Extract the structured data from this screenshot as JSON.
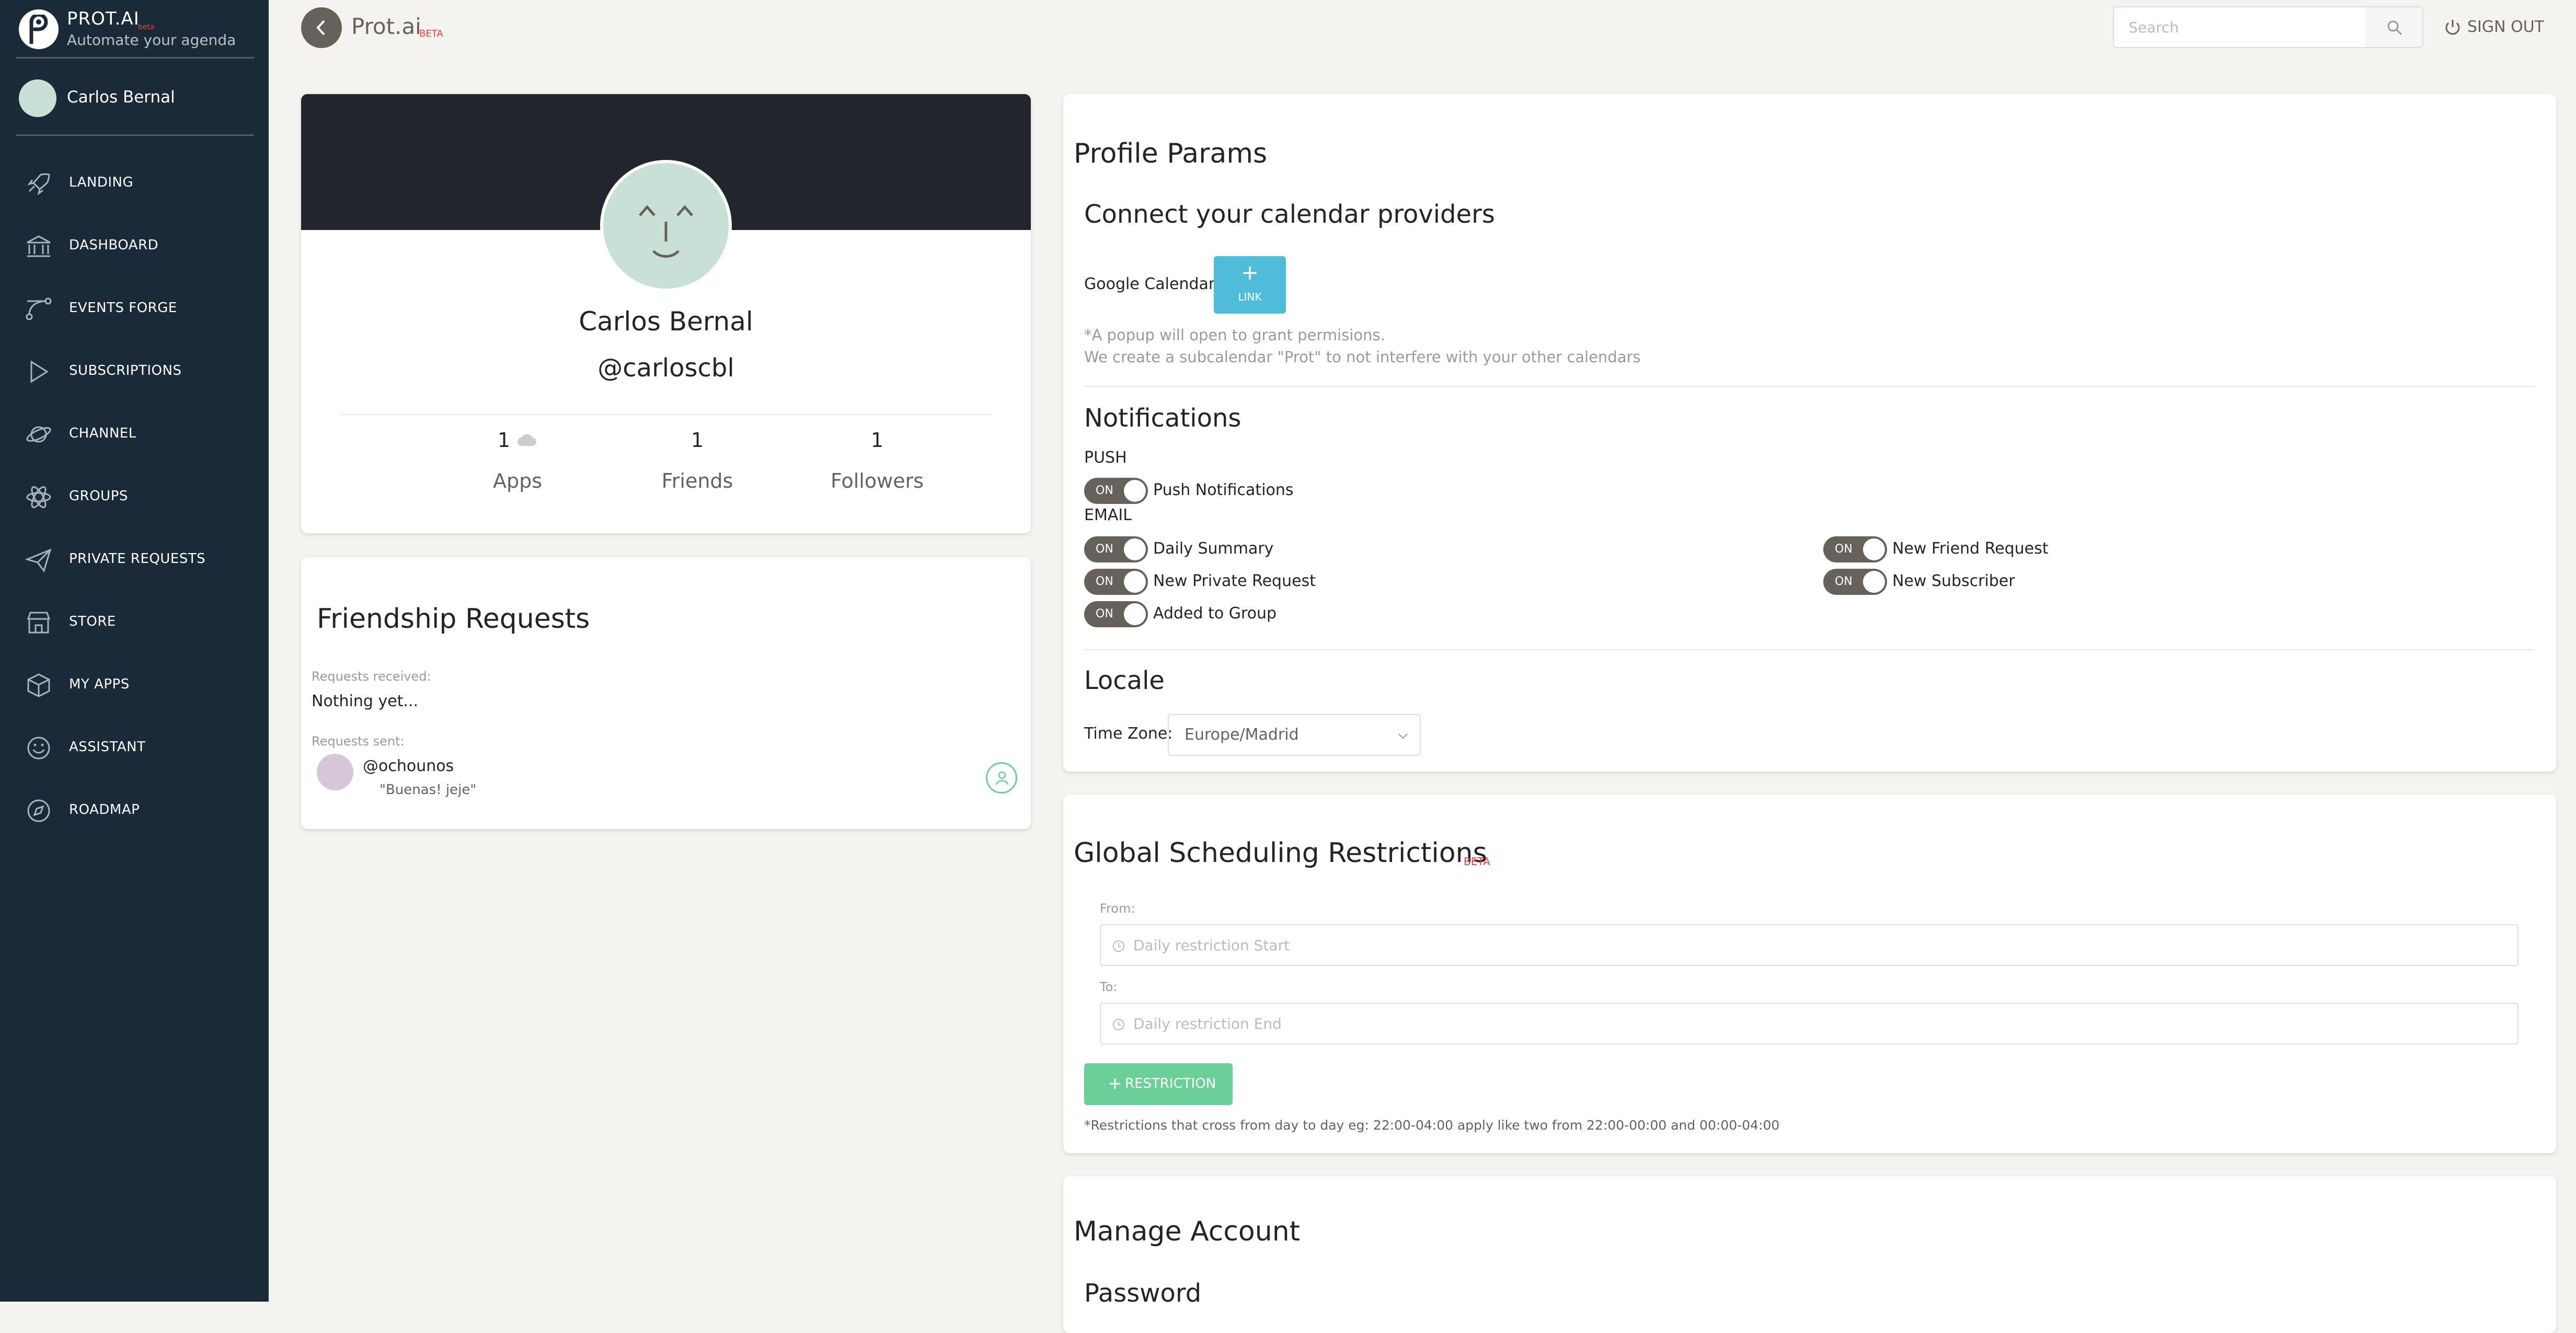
{
  "colors": {
    "sidebar_bg": "#1b2a38",
    "page_bg": "#f4f3ef",
    "accent_info": "#51bcda",
    "accent_success": "#6bd098",
    "beta_red": "#ef3b3b",
    "toggle_bg": "#66615b"
  },
  "sidebar": {
    "brand": {
      "name": "PROT.AI",
      "beta": "beta",
      "tagline": "Automate your agenda"
    },
    "user": {
      "name": "Carlos Bernal"
    },
    "items": [
      {
        "label": "LANDING",
        "icon": "rocket-icon"
      },
      {
        "label": "DASHBOARD",
        "icon": "bank-icon"
      },
      {
        "label": "EVENTS FORGE",
        "icon": "vector-nodes-icon"
      },
      {
        "label": "SUBSCRIPTIONS",
        "icon": "play-icon"
      },
      {
        "label": "CHANNEL",
        "icon": "planet-icon"
      },
      {
        "label": "GROUPS",
        "icon": "atom-icon"
      },
      {
        "label": "PRIVATE REQUESTS",
        "icon": "send-icon"
      },
      {
        "label": "STORE",
        "icon": "shop-icon"
      },
      {
        "label": "MY APPS",
        "icon": "box-icon"
      },
      {
        "label": "ASSISTANT",
        "icon": "smile-icon"
      },
      {
        "label": "ROADMAP",
        "icon": "compass-icon"
      }
    ]
  },
  "topbar": {
    "title": "Prot.ai",
    "beta": "BETA",
    "search_placeholder": "Search",
    "signout_label": "SIGN OUT"
  },
  "profile": {
    "name": "Carlos Bernal",
    "handle": "@carloscbl",
    "stats": [
      {
        "value": "1",
        "icon": "cloud-icon",
        "label": "Apps"
      },
      {
        "value": "1",
        "label": "Friends"
      },
      {
        "value": "1",
        "label": "Followers"
      }
    ]
  },
  "friendship": {
    "title": "Friendship Requests",
    "received_label": "Requests received:",
    "received_empty": "Nothing yet...",
    "sent_label": "Requests sent:",
    "sent": [
      {
        "handle": "@ochounos",
        "message": "\"Buenas! jeje\""
      }
    ]
  },
  "params": {
    "title": "Profile Params",
    "calendar": {
      "heading": "Connect your calendar providers",
      "google_label": "Google Calendar:",
      "link_plus": "+",
      "link_label": "LINK",
      "note1": "*A popup will open to grant permisions.",
      "note2": "We create a subcalendar \"Prot\" to not interfere with your other calendars"
    },
    "notifications": {
      "heading": "Notifications",
      "push_label": "PUSH",
      "email_label": "EMAIL",
      "on_text": "ON",
      "push": [
        {
          "label": "Push Notifications",
          "on": true
        }
      ],
      "email_left": [
        {
          "label": "Daily Summary",
          "on": true
        },
        {
          "label": "New Private Request",
          "on": true
        },
        {
          "label": "Added to Group",
          "on": true
        }
      ],
      "email_right": [
        {
          "label": "New Friend Request",
          "on": true
        },
        {
          "label": "New Subscriber",
          "on": true
        }
      ]
    },
    "locale": {
      "heading": "Locale",
      "timezone_label": "Time Zone:",
      "timezone_value": "Europe/Madrid"
    }
  },
  "scheduling": {
    "title": "Global Scheduling Restrictions",
    "beta": "BETA",
    "from_label": "From:",
    "from_placeholder": "Daily restriction Start",
    "to_label": "To:",
    "to_placeholder": "Daily restriction End",
    "add_button": "RESTRICTION",
    "note": "*Restrictions that cross from day to day eg: 22:00-04:00 apply like two from 22:00-00:00 and 00:00-04:00"
  },
  "account": {
    "title": "Manage Account",
    "password_heading": "Password"
  }
}
